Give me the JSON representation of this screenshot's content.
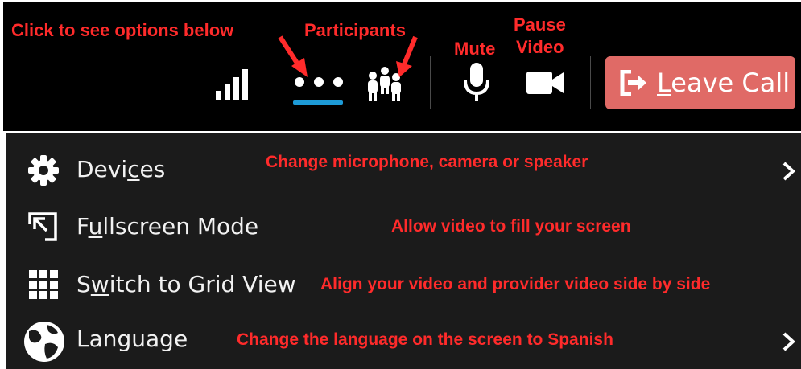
{
  "annotations": {
    "menu_hint": "Click to see  options below",
    "participants": "Participants",
    "mute": "Mute",
    "pause_video_line1": "Pause",
    "pause_video_line2": "Video"
  },
  "toolbar": {
    "icons": [
      "signal-strength-icon",
      "more-options-icon",
      "participants-icon",
      "microphone-icon",
      "video-camera-icon"
    ],
    "leave": {
      "icon": "exit-icon",
      "label_hotkey": "L",
      "label_rest": "eave Call",
      "color": "#e06a66"
    },
    "active_indicator_color": "#1d9bd7",
    "background": "#000000"
  },
  "menu": {
    "background": "#1b1b1b",
    "items": [
      {
        "icon": "gear-icon",
        "label_pre": "Devi",
        "label_hotkey": "c",
        "label_post": "es",
        "has_submenu": true,
        "annotation": "Change microphone, camera or speaker"
      },
      {
        "icon": "fullscreen-icon",
        "label_pre": "F",
        "label_hotkey": "u",
        "label_post": "llscreen Mode",
        "has_submenu": false,
        "annotation": "Allow video to fill your screen"
      },
      {
        "icon": "grid-icon",
        "label_pre": "S",
        "label_hotkey": "w",
        "label_post": "itch to Grid View",
        "has_submenu": false,
        "annotation": "Align your video and provider video side by side"
      },
      {
        "icon": "globe-icon",
        "label_pre": "Language",
        "label_hotkey": "",
        "label_post": "",
        "has_submenu": true,
        "annotation": "Change the language on the screen to Spanish"
      }
    ]
  },
  "colors": {
    "annotation": "#ff2b2b",
    "arrow": "#ff2b2b"
  }
}
